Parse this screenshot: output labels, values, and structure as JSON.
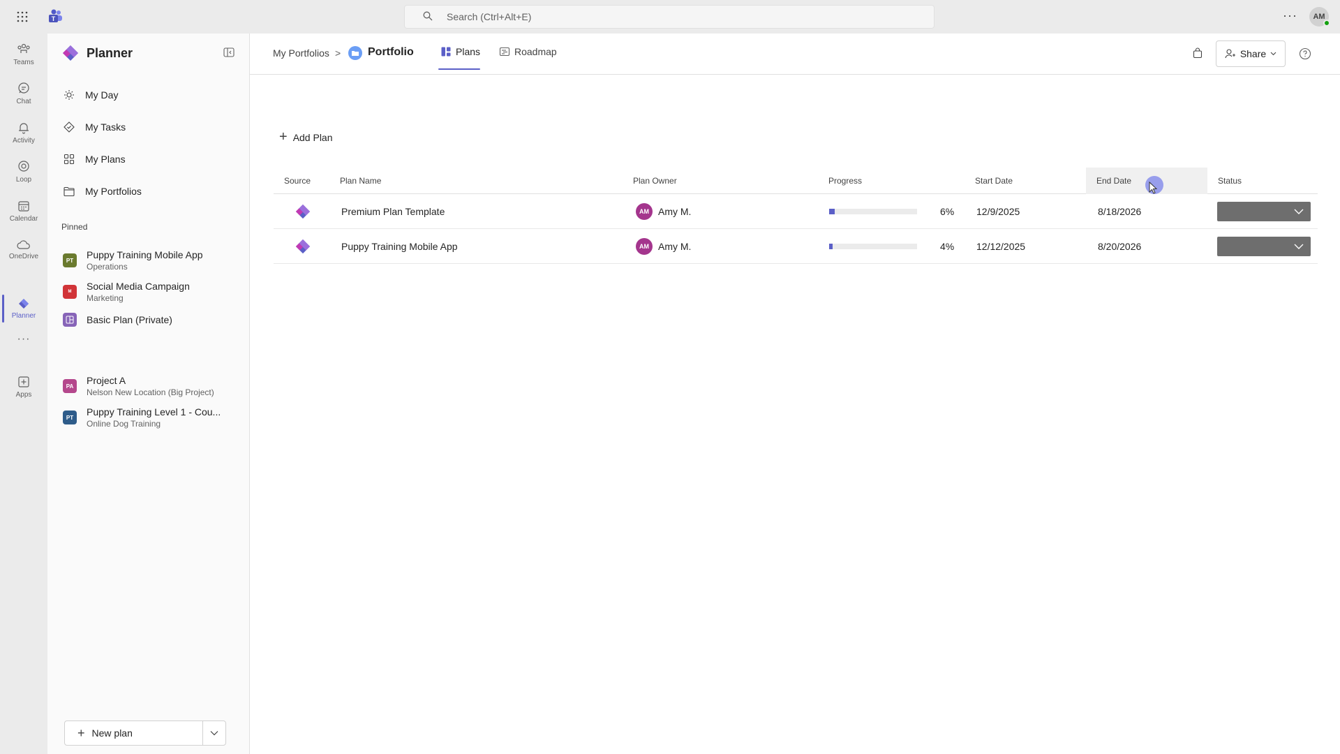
{
  "topbar": {
    "search_placeholder": "Search (Ctrl+Alt+E)",
    "more_label": "···",
    "avatar_initials": "AM"
  },
  "rail": {
    "items": [
      {
        "label": "Teams",
        "icon": "teams-icon"
      },
      {
        "label": "Chat",
        "icon": "chat-icon"
      },
      {
        "label": "Activity",
        "icon": "bell-icon"
      },
      {
        "label": "Loop",
        "icon": "loop-icon"
      },
      {
        "label": "Calendar",
        "icon": "calendar-icon"
      },
      {
        "label": "OneDrive",
        "icon": "cloud-icon"
      },
      {
        "label": "Planner",
        "icon": "planner-icon"
      },
      {
        "label": "Apps",
        "icon": "add-app-icon"
      }
    ],
    "more_label": "···"
  },
  "sidepanel": {
    "title": "Planner",
    "nav": [
      {
        "label": "My Day",
        "icon": "sun-icon"
      },
      {
        "label": "My Tasks",
        "icon": "tasks-icon"
      },
      {
        "label": "My Plans",
        "icon": "grid-icon"
      },
      {
        "label": "My Portfolios",
        "icon": "folder-icon"
      }
    ],
    "pinned_label": "Pinned",
    "pinned": [
      {
        "badge": "PT",
        "name": "Puppy Training Mobile App",
        "sub": "Operations",
        "color": "#6a7a2e"
      },
      {
        "badge": "M",
        "name": "Social Media Campaign",
        "sub": "Marketing",
        "color": "#d13438"
      },
      {
        "badge": "",
        "name": "Basic Plan (Private)",
        "sub": "",
        "color": "#8764b8"
      },
      {
        "badge": "PA",
        "name": "Project A",
        "sub": "Nelson New Location (Big Project)",
        "color": "#b4478c"
      },
      {
        "badge": "PT",
        "name": "Puppy Training Level 1 - Cou...",
        "sub": "Online Dog Training",
        "color": "#2e5c8a"
      }
    ],
    "new_plan_label": "New plan"
  },
  "header": {
    "breadcrumb": "My Portfolios",
    "breadcrumb_sep": ">",
    "title": "Portfolio",
    "tabs": [
      {
        "label": "Plans"
      },
      {
        "label": "Roadmap"
      }
    ],
    "share_label": "Share"
  },
  "content": {
    "add_plan_label": "Add Plan",
    "columns": [
      "Source",
      "Plan Name",
      "Plan Owner",
      "Progress",
      "Start Date",
      "End Date",
      "Status"
    ],
    "rows": [
      {
        "name": "Premium Plan Template",
        "owner_initials": "AM",
        "owner": "Amy M.",
        "progress": 6,
        "progress_label": "6%",
        "start": "12/9/2025",
        "end": "8/18/2026"
      },
      {
        "name": "Puppy Training Mobile App",
        "owner_initials": "AM",
        "owner": "Amy M.",
        "progress": 4,
        "progress_label": "4%",
        "start": "12/12/2025",
        "end": "8/20/2026"
      }
    ]
  },
  "colors": {
    "accent": "#5b5fc7",
    "status_dropdown": "#6e6e6e"
  }
}
